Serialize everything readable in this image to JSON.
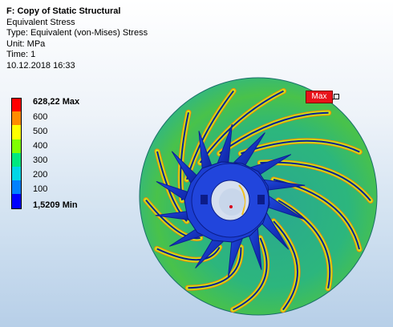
{
  "info": {
    "title": "F: Copy of Static Structural",
    "result": "Equivalent Stress",
    "type": "Type: Equivalent (von-Mises) Stress",
    "unit": "Unit: MPa",
    "time": "Time: 1",
    "date": "10.12.2018 16:33"
  },
  "legend": {
    "max_label": "628,22 Max",
    "min_label": "1,5209 Min",
    "ticks": [
      "600",
      "500",
      "400",
      "300",
      "200",
      "100"
    ],
    "colors": [
      "#ff0000",
      "#ff8c00",
      "#ffff00",
      "#7fff00",
      "#00e87f",
      "#00d6e6",
      "#0081ff",
      "#0000ff"
    ]
  },
  "probe": {
    "max_tag": "Max"
  },
  "model": {
    "colors": {
      "disc": "#2bb58a",
      "disc_edge": "#4fc23b",
      "hot": "#ff8c00",
      "warm": "#c8e61a",
      "blade": "#1a3fcf",
      "blade_dark": "#0c1f96",
      "hub": "#1d3fd6",
      "bore": "#d2ddec"
    }
  }
}
